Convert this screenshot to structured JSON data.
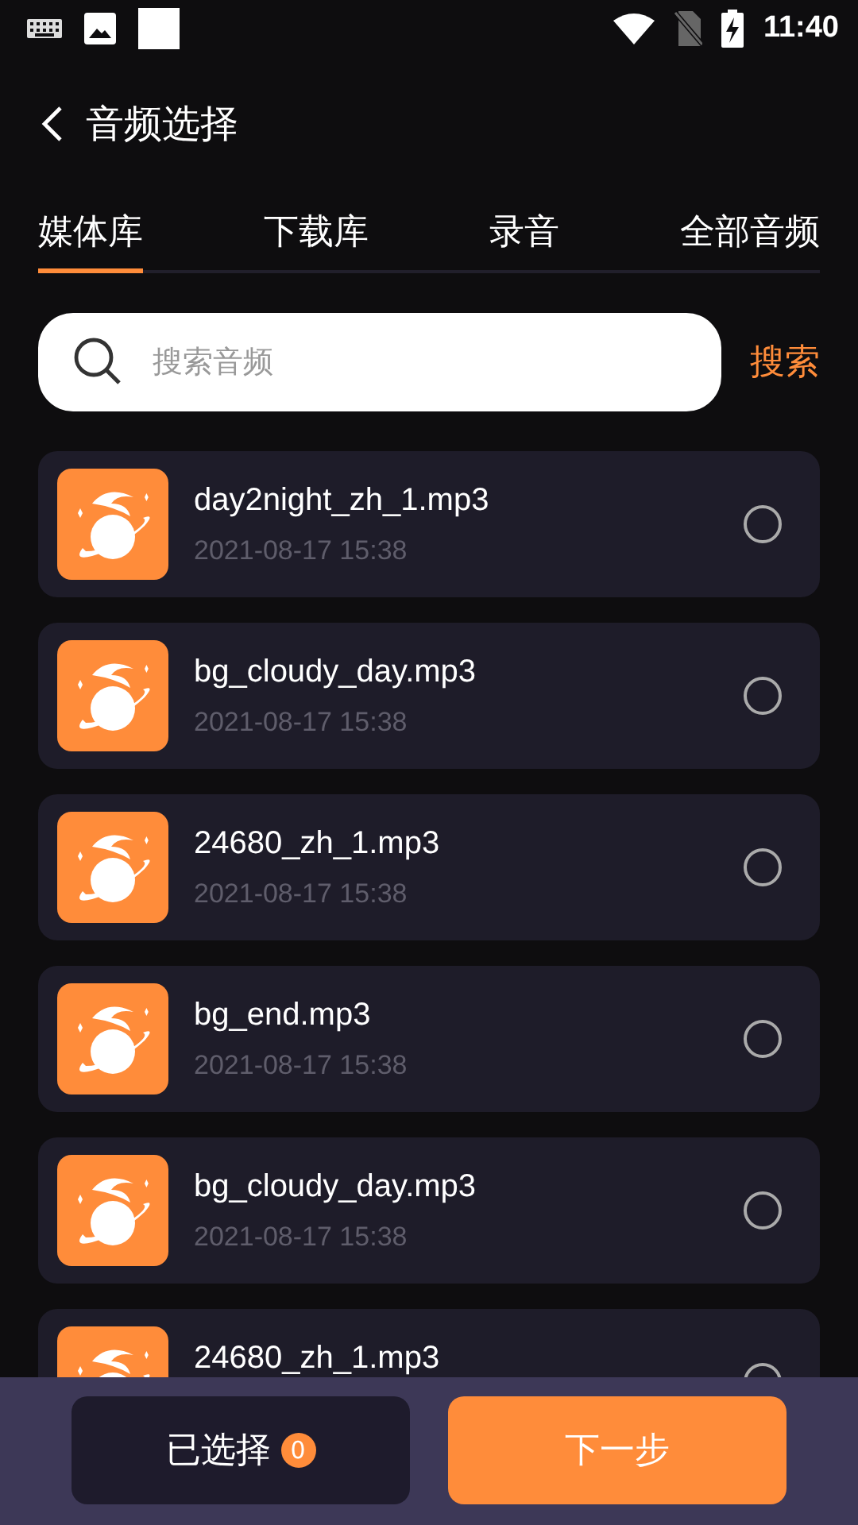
{
  "status_bar": {
    "time": "11:40"
  },
  "header": {
    "title": "音频选择"
  },
  "tabs": [
    {
      "label": "媒体库",
      "selected": true
    },
    {
      "label": "下载库",
      "selected": false
    },
    {
      "label": "录音",
      "selected": false
    },
    {
      "label": "全部音频",
      "selected": false
    }
  ],
  "search": {
    "placeholder": "搜索音频",
    "button": "搜索"
  },
  "files": [
    {
      "name": "day2night_zh_1.mp3",
      "date": "2021-08-17 15:38",
      "selected": false
    },
    {
      "name": "bg_cloudy_day.mp3",
      "date": "2021-08-17 15:38",
      "selected": false
    },
    {
      "name": "24680_zh_1.mp3",
      "date": "2021-08-17 15:38",
      "selected": false
    },
    {
      "name": "bg_end.mp3",
      "date": "2021-08-17 15:38",
      "selected": false
    },
    {
      "name": "bg_cloudy_day.mp3",
      "date": "2021-08-17 15:38",
      "selected": false
    },
    {
      "name": "24680_zh_1.mp3",
      "selected": false
    }
  ],
  "bottom_bar": {
    "selected_label": "已选择",
    "selected_count": "0",
    "next_button": "下一步"
  }
}
